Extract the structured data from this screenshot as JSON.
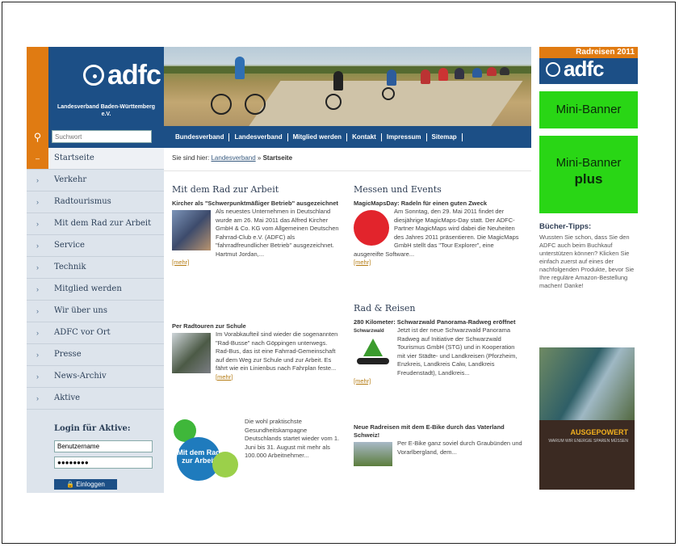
{
  "logo": {
    "name": "adfc",
    "subtitle": "Landesverband Baden-Württemberg e.V."
  },
  "search": {
    "placeholder": "Suchwort"
  },
  "topnav": [
    "Bundesverband",
    "Landesverband",
    "Mitglied werden",
    "Kontakt",
    "Impressum",
    "Sitemap"
  ],
  "sidebar": {
    "items": [
      {
        "label": "Startseite",
        "active": true
      },
      {
        "label": "Verkehr"
      },
      {
        "label": "Radtourismus"
      },
      {
        "label": "Mit dem Rad zur Arbeit"
      },
      {
        "label": "Service"
      },
      {
        "label": "Technik"
      },
      {
        "label": "Mitglied werden"
      },
      {
        "label": "Wir über uns"
      },
      {
        "label": "ADFC vor Ort"
      },
      {
        "label": "Presse"
      },
      {
        "label": "News-Archiv"
      },
      {
        "label": "Aktive"
      }
    ]
  },
  "login": {
    "title": "Login für Aktive:",
    "username": "Benutzername",
    "password": "●●●●●●●●",
    "button": "Einloggen"
  },
  "breadcrumb": {
    "prefix": "Sie sind hier:",
    "link": "Landesverband",
    "sep": "»",
    "current": "Startseite"
  },
  "col1": {
    "heading": "Mit dem Rad zur Arbeit",
    "a1": {
      "title": "Kircher als \"Schwerpunktmäßiger Betrieb\" ausgezeichnet",
      "text": "Als neuestes Unternehmen in Deutschland wurde am 26. Mai 2011 das Alfred Kircher GmbH & Co. KG vom Allgemeinen Deutschen Fahrrad-Club e.V. (ADFC) als \"fahrradfreundlicher Betrieb\" ausgezeichnet. Hartmut Jordan,...",
      "more": "[mehr]"
    },
    "a2": {
      "title": "Per Radtouren zur Schule",
      "text": "Im Vorabkaufteil sind wieder die sogenannten \"Rad-Busse\" nach Göppingen unterwegs. Rad-Bus, das ist eine Fahrrad-Gemeinschaft auf dem Weg zur Schule und zur Arbeit. Es fährt wie ein Linienbus nach Fahrplan feste...",
      "more": "[mehr]"
    },
    "a3": {
      "logo_text": "Mit dem Rad zur Arbeit",
      "text": "Die wohl praktischste Gesundheitskampagne Deutschlands startet wieder vom 1. Juni bis 31. August mit mehr als 100.000 Arbeitnehmer..."
    }
  },
  "col2": {
    "heading1": "Messen und Events",
    "b1": {
      "title": "MagicMapsDay: Radeln für einen guten Zweck",
      "text": "Am Sonntag, den 29. Mai 2011 findet der diesjährige MagicMaps-Day statt. Der ADFC-Partner MagicMaps wird dabei die Neuheiten des Jahres 2011 präsentieren. Die MagicMaps GmbH stellt das \"Tour Explorer\", eine ausgereifte Software...",
      "more": "[mehr]"
    },
    "heading2": "Rad & Reisen",
    "b2": {
      "title": "280 Kilometer: Schwarzwald Panorama-Radweg eröffnet",
      "logo_text": "Schwarzwald",
      "text": "Jetzt ist der neue Schwarzwald Panorama Radweg auf Initiative der Schwarzwald Tourismus GmbH (STG) und in Kooperation mit vier Städte- und Landkreisen (Pforzheim, Enzkreis, Landkreis Calw, Landkreis Freudenstadt), Landkreis...",
      "more": "[mehr]"
    },
    "b3": {
      "title": "Neue Radreisen mit dem E-Bike durch das Vaterland Schweiz!",
      "text": "Per E-Bike ganz soviel durch Graubünden und Vorarlbergland, dem..."
    }
  },
  "banners": {
    "radreisen_year": "Radreisen 2011",
    "radreisen_name": "adfc",
    "mini": "Mini-Banner",
    "mini_plus_1": "Mini-Banner",
    "mini_plus_2": "plus"
  },
  "tips": {
    "title": "Bücher-Tipps:",
    "text": "Wussten Sie schon, dass Sie den ADFC auch beim Buchkauf unterstützen können? Klicken Sie einfach zuerst auf eines der nachfolgenden Produkte, bevor Sie Ihre reguläre Amazon-Bestellung machen! Danke!"
  },
  "book": {
    "title": "AUSGEPOWERT",
    "subtitle": "WARUM WIR ENERGIE SPAREN MÜSSEN"
  },
  "colors": {
    "blue": "#1c4f86",
    "orange": "#e07b12",
    "green": "#29d615"
  }
}
